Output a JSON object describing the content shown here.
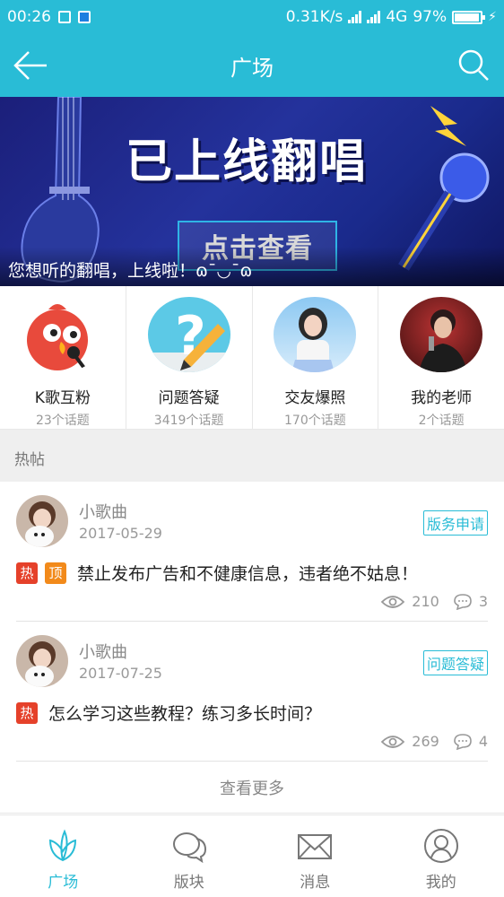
{
  "status_bar": {
    "time": "00:26",
    "network_speed": "0.31K/s",
    "network_type": "4G",
    "battery": "97%",
    "battery_level": 0.97
  },
  "app_bar": {
    "title": "广场",
    "back_icon": "arrow-left-icon",
    "search_icon": "search-icon"
  },
  "banner": {
    "headline": "已上线翻唱",
    "cta": "点击查看",
    "caption": "您想听的翻唱，上线啦！ɷ¯◡¯ɷ"
  },
  "categories": [
    {
      "name": "K歌互粉",
      "count": "23个话题"
    },
    {
      "name": "问题答疑",
      "count": "3419个话题"
    },
    {
      "name": "交友爆照",
      "count": "170个话题"
    },
    {
      "name": "我的老师",
      "count": "2个话题"
    }
  ],
  "hot_section": {
    "title": "热帖"
  },
  "posts": [
    {
      "author": "小歌曲",
      "date": "2017-05-29",
      "tag": "版务申请",
      "badges": [
        "热",
        "顶"
      ],
      "title": "禁止发布广告和不健康信息，违者绝不姑息！",
      "views": "210",
      "comments": "3"
    },
    {
      "author": "小歌曲",
      "date": "2017-07-25",
      "tag": "问题答疑",
      "badges": [
        "热"
      ],
      "title": "怎么学习这些教程？练习多长时间？",
      "views": "269",
      "comments": "4"
    }
  ],
  "more_label": "查看更多",
  "tabs": [
    {
      "label": "广场",
      "icon": "leaf-icon",
      "active": true
    },
    {
      "label": "版块",
      "icon": "chat-bubbles-icon",
      "active": false
    },
    {
      "label": "消息",
      "icon": "envelope-icon",
      "active": false
    },
    {
      "label": "我的",
      "icon": "user-icon",
      "active": false
    }
  ],
  "colors": {
    "accent": "#29bcd6",
    "hot_badge": "#e5412a",
    "top_badge": "#f28a1b"
  }
}
